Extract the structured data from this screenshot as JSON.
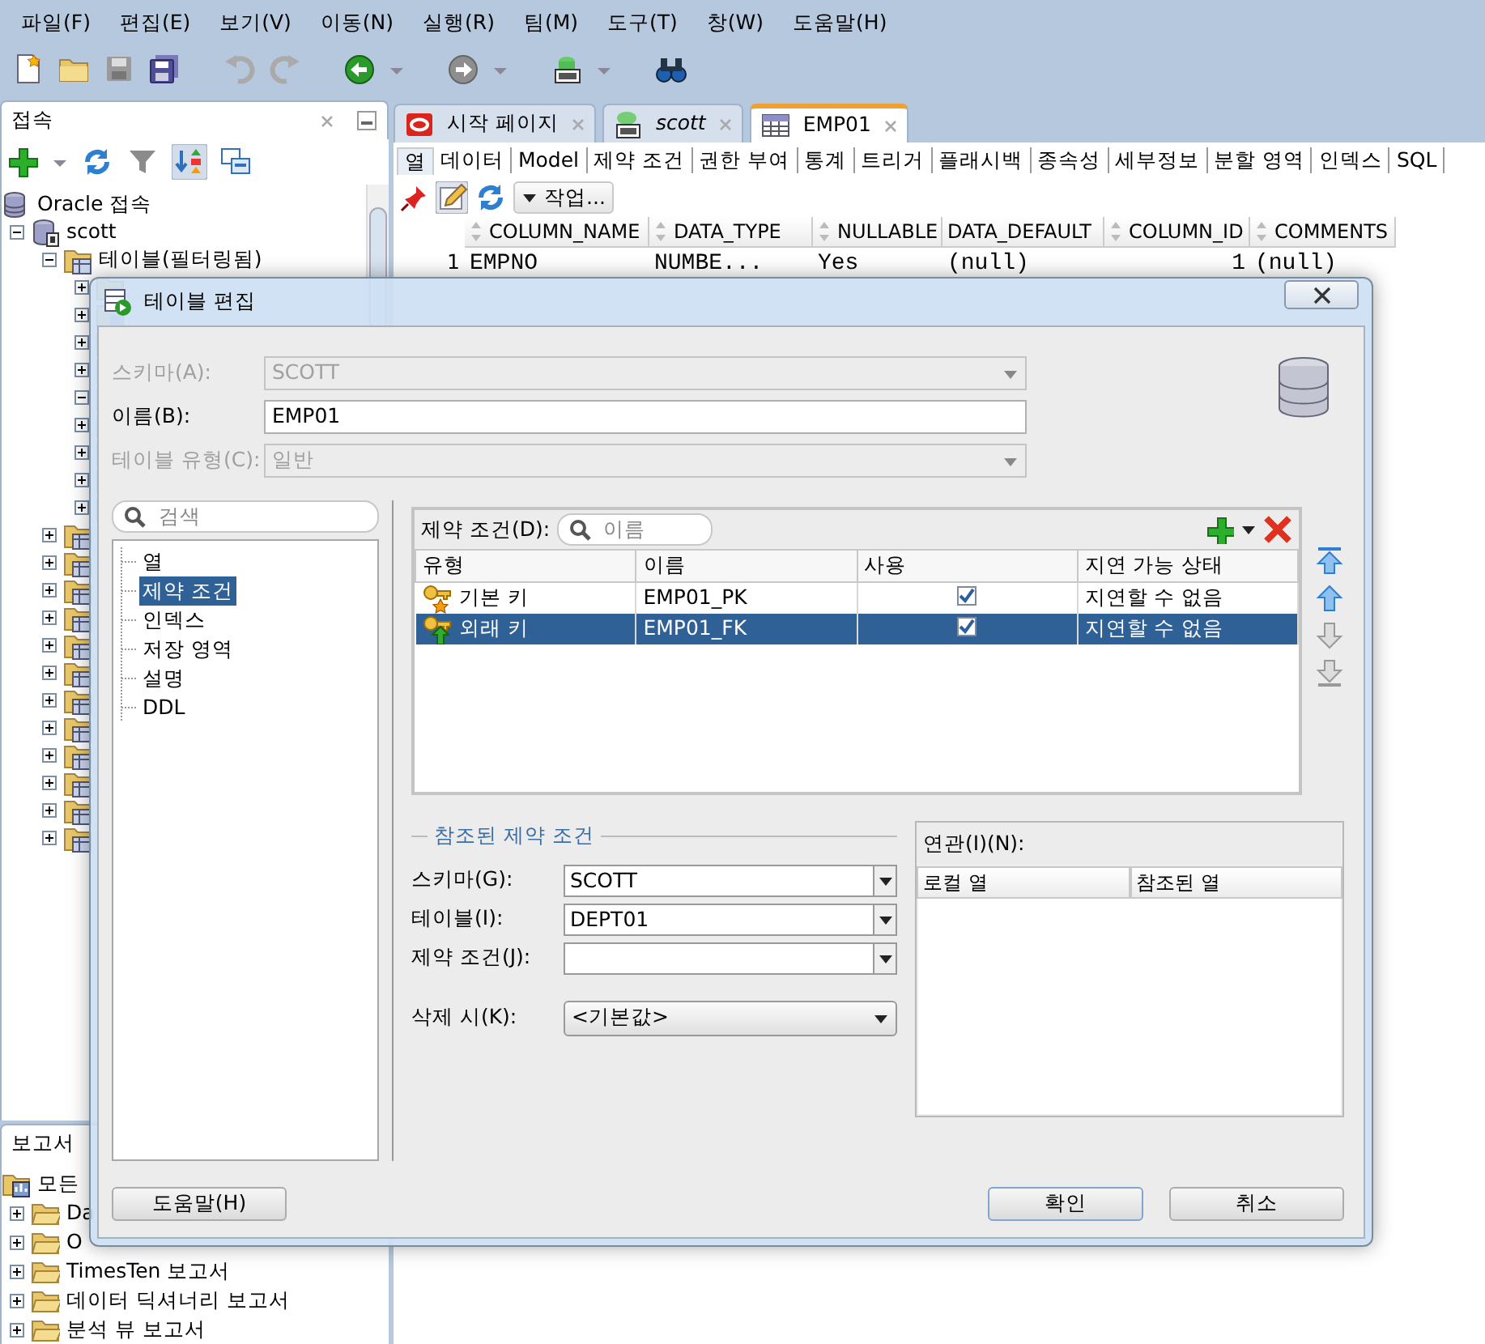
{
  "menu": [
    "파일(F)",
    "편집(E)",
    "보기(V)",
    "이동(N)",
    "실행(R)",
    "팀(M)",
    "도구(T)",
    "창(W)",
    "도움말(H)"
  ],
  "connections_panel": {
    "title": "접속",
    "tree": [
      {
        "label": "Oracle 접속",
        "children": [
          {
            "label": "scott",
            "expanded": true,
            "children": [
              {
                "label": "테이블(필터링됨)",
                "expanded": true,
                "children": [
                  {
                    "expanded": false
                  },
                  {
                    "expanded": false
                  },
                  {
                    "expanded": false
                  },
                  {
                    "expanded": false
                  },
                  {
                    "expanded": true
                  },
                  {
                    "expanded": false
                  },
                  {
                    "expanded": false
                  },
                  {
                    "expanded": false
                  },
                  {
                    "expanded": false
                  }
                ]
              },
              {
                "expanded": false
              },
              {
                "expanded": false
              },
              {
                "expanded": false
              },
              {
                "expanded": false
              },
              {
                "expanded": false
              },
              {
                "expanded": false
              },
              {
                "expanded": false
              },
              {
                "expanded": false
              },
              {
                "expanded": false
              },
              {
                "expanded": false
              },
              {
                "expanded": false
              },
              {
                "expanded": false
              }
            ]
          }
        ]
      }
    ]
  },
  "reports_panel": {
    "title": "보고서",
    "tree": [
      {
        "label": "모든",
        "children": [
          {
            "label": "Da",
            "expanded": false
          },
          {
            "label": "O",
            "expanded": false
          },
          {
            "label": "TimesTen 보고서",
            "expanded": false
          },
          {
            "label": "데이터 딕셔너리 보고서",
            "expanded": false
          },
          {
            "label": "분석 뷰 보고서",
            "expanded": false
          }
        ]
      }
    ]
  },
  "editor_tabs": [
    {
      "label": "시작 페이지",
      "kind": "start",
      "selected": false
    },
    {
      "label": "scott",
      "kind": "sql",
      "selected": false
    },
    {
      "label": "EMP01",
      "kind": "table",
      "selected": true
    }
  ],
  "subtabs": [
    {
      "label": "열",
      "selected": true
    },
    {
      "label": "데이터",
      "selected": false
    },
    {
      "label": "Model",
      "selected": false
    },
    {
      "label": "제약 조건",
      "selected": false
    },
    {
      "label": "권한 부여",
      "selected": false
    },
    {
      "label": "통계",
      "selected": false
    },
    {
      "label": "트리거",
      "selected": false
    },
    {
      "label": "플래시백",
      "selected": false
    },
    {
      "label": "종속성",
      "selected": false
    },
    {
      "label": "세부정보",
      "selected": false
    },
    {
      "label": "분할 영역",
      "selected": false
    },
    {
      "label": "인덱스",
      "selected": false
    },
    {
      "label": "SQL",
      "selected": false
    }
  ],
  "actions_button": "작업...",
  "grid": {
    "columns": [
      "COLUMN_NAME",
      "DATA_TYPE",
      "NULLABLE",
      "DATA_DEFAULT",
      "COLUMN_ID",
      "COMMENTS"
    ],
    "rows": [
      {
        "number": "1",
        "cells": [
          "EMPNO",
          "NUMBE...",
          "Yes",
          "(null)",
          "1",
          "(null)"
        ]
      }
    ]
  },
  "dialog": {
    "title": "테이블 편집",
    "fields": [
      {
        "label": "스키마(A):",
        "value": "SCOTT",
        "kind": "combo",
        "disabled": true
      },
      {
        "label": "이름(B):",
        "value": "EMP01",
        "kind": "text",
        "disabled": false
      },
      {
        "label": "테이블 유형(C):",
        "value": "일반",
        "kind": "combo",
        "disabled": true
      }
    ],
    "search_placeholder": "검색",
    "nav": [
      {
        "label": "열",
        "selected": false
      },
      {
        "label": "제약 조건",
        "selected": true
      },
      {
        "label": "인덱스",
        "selected": false
      },
      {
        "label": "저장 영역",
        "selected": false
      },
      {
        "label": "설명",
        "selected": false
      },
      {
        "label": "DDL",
        "selected": false
      }
    ],
    "constraints": {
      "label": "제약 조건(D):",
      "search_placeholder": "이름",
      "columns": [
        "유형",
        "이름",
        "사용",
        "지연 가능 상태"
      ],
      "rows": [
        {
          "kind": "primary",
          "type": "기본 키",
          "name": "EMP01_PK",
          "enabled": true,
          "deferrable": "지연할 수 없음",
          "selected": false
        },
        {
          "kind": "foreign",
          "type": "외래 키",
          "name": "EMP01_FK",
          "enabled": true,
          "deferrable": "지연할 수 없음",
          "selected": true
        }
      ]
    },
    "referenced": {
      "title": "참조된 제약 조건",
      "fields": [
        {
          "label": "스키마(G):",
          "value": "SCOTT"
        },
        {
          "label": "테이블(I):",
          "value": "DEPT01"
        },
        {
          "label": "제약 조건(J):"
        }
      ],
      "on_delete": {
        "label": "삭제 시(K):",
        "value": "<기본값>"
      }
    },
    "association": {
      "label": "연관(I)(N):",
      "columns": [
        "로컬 열",
        "참조된 열"
      ]
    },
    "help_button": "도움말(H)",
    "ok_button": "확인",
    "cancel_button": "취소"
  }
}
